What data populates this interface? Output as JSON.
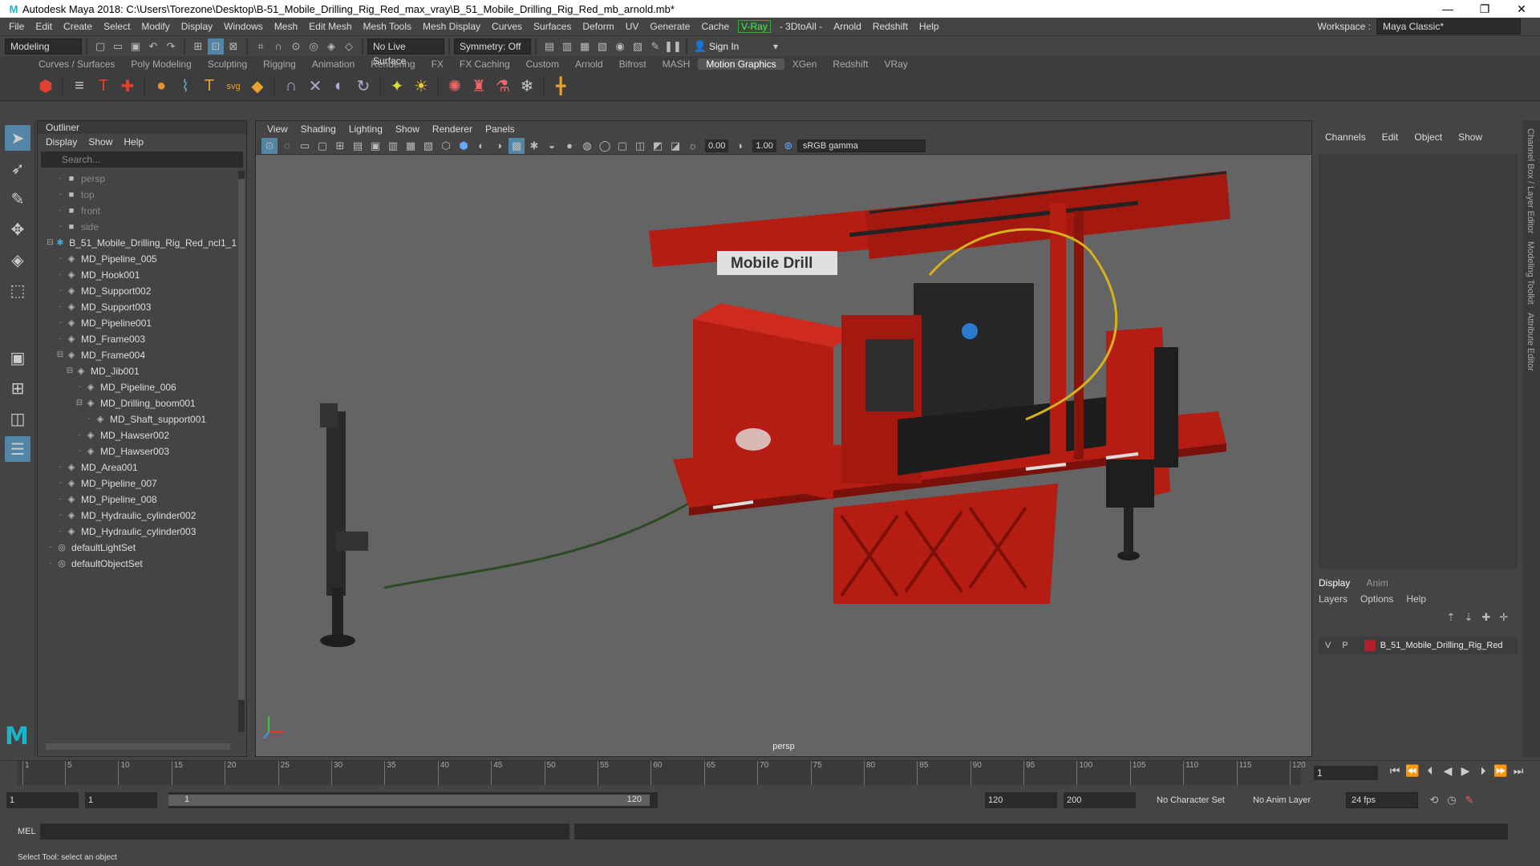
{
  "titlebar": {
    "title": "Autodesk Maya 2018: C:\\Users\\Torezone\\Desktop\\B-51_Mobile_Drilling_Rig_Red_max_vray\\B_51_Mobile_Drilling_Rig_Red_mb_arnold.mb*"
  },
  "menu": [
    "File",
    "Edit",
    "Create",
    "Select",
    "Modify",
    "Display",
    "Windows",
    "Mesh",
    "Edit Mesh",
    "Mesh Tools",
    "Mesh Display",
    "Curves",
    "Surfaces",
    "Deform",
    "UV",
    "Generate",
    "Cache"
  ],
  "menu_vray": "V-Ray",
  "menu2": [
    "- 3DtoAll -",
    "Arnold",
    "Redshift",
    "Help"
  ],
  "workspace": {
    "label": "Workspace :",
    "value": "Maya Classic*"
  },
  "status": {
    "mode": "Modeling",
    "live": "No Live Surface",
    "symmetry": "Symmetry: Off",
    "signin": "Sign In"
  },
  "shelftabs": [
    "Curves / Surfaces",
    "Poly Modeling",
    "Sculpting",
    "Rigging",
    "Animation",
    "Rendering",
    "FX",
    "FX Caching",
    "Custom",
    "Arnold",
    "Bifrost",
    "MASH",
    "Motion Graphics",
    "XGen",
    "Redshift",
    "VRay"
  ],
  "shelf_active": "Motion Graphics",
  "outliner": {
    "title": "Outliner",
    "menu": [
      "Display",
      "Show",
      "Help"
    ],
    "search": "Search...",
    "items": [
      {
        "label": "persp",
        "depth": 1,
        "icon": "camera-icon",
        "dim": true
      },
      {
        "label": "top",
        "depth": 1,
        "icon": "camera-icon",
        "dim": true
      },
      {
        "label": "front",
        "depth": 1,
        "icon": "camera-icon",
        "dim": true
      },
      {
        "label": "side",
        "depth": 1,
        "icon": "camera-icon",
        "dim": true
      },
      {
        "label": "B_51_Mobile_Drilling_Rig_Red_ncl1_1",
        "depth": 0,
        "icon": "group-icon",
        "exp": "⊟"
      },
      {
        "label": "MD_Pipeline_005",
        "depth": 1,
        "icon": "mesh-icon"
      },
      {
        "label": "MD_Hook001",
        "depth": 1,
        "icon": "mesh-icon"
      },
      {
        "label": "MD_Support002",
        "depth": 1,
        "icon": "mesh-icon"
      },
      {
        "label": "MD_Support003",
        "depth": 1,
        "icon": "mesh-icon"
      },
      {
        "label": "MD_Pipeline001",
        "depth": 1,
        "icon": "mesh-icon"
      },
      {
        "label": "MD_Frame003",
        "depth": 1,
        "icon": "mesh-icon"
      },
      {
        "label": "MD_Frame004",
        "depth": 1,
        "icon": "mesh-icon",
        "exp": "⊟"
      },
      {
        "label": "MD_Jib001",
        "depth": 2,
        "icon": "mesh-icon",
        "exp": "⊟"
      },
      {
        "label": "MD_Pipeline_006",
        "depth": 3,
        "icon": "mesh-icon"
      },
      {
        "label": "MD_Drilling_boom001",
        "depth": 3,
        "icon": "mesh-icon",
        "exp": "⊟"
      },
      {
        "label": "MD_Shaft_support001",
        "depth": 4,
        "icon": "mesh-icon"
      },
      {
        "label": "MD_Hawser002",
        "depth": 3,
        "icon": "mesh-icon"
      },
      {
        "label": "MD_Hawser003",
        "depth": 3,
        "icon": "mesh-icon"
      },
      {
        "label": "MD_Area001",
        "depth": 1,
        "icon": "mesh-icon"
      },
      {
        "label": "MD_Pipeline_007",
        "depth": 1,
        "icon": "mesh-icon"
      },
      {
        "label": "MD_Pipeline_008",
        "depth": 1,
        "icon": "mesh-icon"
      },
      {
        "label": "MD_Hydraulic_cylinder002",
        "depth": 1,
        "icon": "mesh-icon"
      },
      {
        "label": "MD_Hydraulic_cylinder003",
        "depth": 1,
        "icon": "mesh-icon"
      },
      {
        "label": "defaultLightSet",
        "depth": 0,
        "icon": "set-icon"
      },
      {
        "label": "defaultObjectSet",
        "depth": 0,
        "icon": "set-icon"
      }
    ]
  },
  "viewport": {
    "menu": [
      "View",
      "Shading",
      "Lighting",
      "Show",
      "Renderer",
      "Panels"
    ],
    "val1": "0.00",
    "val2": "1.00",
    "colorspace": "sRGB gamma",
    "camera": "persp",
    "decal_text": "Mobile Drill",
    "colors": {
      "body": "#b51c12",
      "dark": "#2a2a2a",
      "bg": "#646464"
    }
  },
  "channelbox": {
    "menu": [
      "Channels",
      "Edit",
      "Object",
      "Show"
    ],
    "vtabs": [
      "Channel Box / Layer Editor",
      "Modeling Toolkit",
      "Attribute Editor"
    ]
  },
  "layers": {
    "tabs": [
      "Display",
      "Anim"
    ],
    "menu": [
      "Layers",
      "Options",
      "Help"
    ],
    "v": "V",
    "p": "P",
    "name": "B_51_Mobile_Drilling_Rig_Red",
    "color": "#b11d2a"
  },
  "timeline": {
    "ticks": [
      "1",
      "5",
      "10",
      "15",
      "20",
      "25",
      "30",
      "35",
      "40",
      "45",
      "50",
      "55",
      "60",
      "65",
      "70",
      "75",
      "80",
      "85",
      "90",
      "95",
      "100",
      "105",
      "110",
      "115",
      "120"
    ],
    "current": "1"
  },
  "range": {
    "start": "1",
    "start2": "1",
    "bar_start": "1",
    "bar_end": "120",
    "end": "120",
    "end2": "200",
    "charset": "No Character Set",
    "animlayer": "No Anim Layer",
    "fps": "24 fps"
  },
  "cmd": {
    "label": "MEL"
  },
  "help": "Select Tool: select an object"
}
